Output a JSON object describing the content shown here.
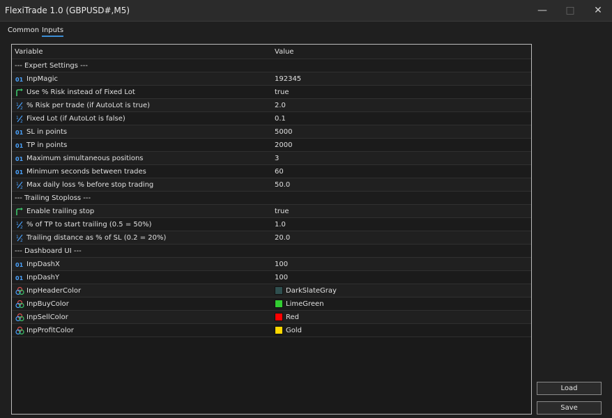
{
  "window": {
    "title": "FlexiTrade 1.0 (GBPUSD#,M5)"
  },
  "tabs": [
    "Common",
    "Inputs"
  ],
  "table": {
    "headers": {
      "variable": "Variable",
      "value": "Value"
    },
    "rows": [
      {
        "type": "section",
        "label": "--- Expert Settings ---"
      },
      {
        "type": "int",
        "label": "InpMagic",
        "value": "192345"
      },
      {
        "type": "bool",
        "label": "Use % Risk instead of Fixed Lot",
        "value": "true"
      },
      {
        "type": "float",
        "label": "% Risk per trade (if AutoLot is true)",
        "value": "2.0"
      },
      {
        "type": "float",
        "label": "Fixed Lot (if AutoLot is false)",
        "value": "0.1"
      },
      {
        "type": "int",
        "label": "SL in points",
        "value": "5000"
      },
      {
        "type": "int",
        "label": "TP in points",
        "value": "2000"
      },
      {
        "type": "int",
        "label": "Maximum simultaneous positions",
        "value": "3"
      },
      {
        "type": "int",
        "label": "Minimum seconds between trades",
        "value": "60"
      },
      {
        "type": "float",
        "label": "Max daily loss % before stop trading",
        "value": "50.0"
      },
      {
        "type": "section",
        "label": "--- Trailing Stoploss ---"
      },
      {
        "type": "bool",
        "label": "Enable trailing stop",
        "value": "true"
      },
      {
        "type": "float",
        "label": "% of TP to start trailing (0.5 = 50%)",
        "value": "1.0"
      },
      {
        "type": "float",
        "label": "Trailing distance as % of SL (0.2 = 20%)",
        "value": "20.0"
      },
      {
        "type": "section",
        "label": "--- Dashboard UI ---"
      },
      {
        "type": "int",
        "label": "InpDashX",
        "value": "100"
      },
      {
        "type": "int",
        "label": "InpDashY",
        "value": "100"
      },
      {
        "type": "color",
        "label": "InpHeaderColor",
        "value": "DarkSlateGray",
        "swatch": "#2F4F4F"
      },
      {
        "type": "color",
        "label": "InpBuyColor",
        "value": "LimeGreen",
        "swatch": "#32CD32"
      },
      {
        "type": "color",
        "label": "InpSellColor",
        "value": "Red",
        "swatch": "#FF0000"
      },
      {
        "type": "color",
        "label": "InpProfitColor",
        "value": "Gold",
        "swatch": "#FFD700"
      }
    ]
  },
  "buttons": {
    "load": "Load",
    "save": "Save"
  }
}
